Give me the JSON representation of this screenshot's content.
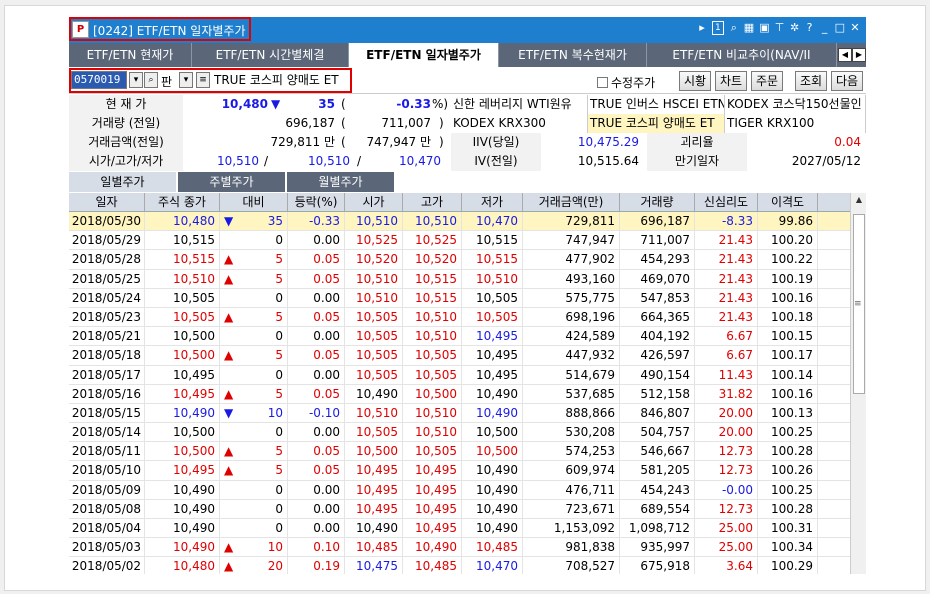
{
  "window": {
    "title": "[0242] ETF/ETN 일자별주가"
  },
  "tabs": [
    "ETF/ETN 현재가",
    "ETF/ETN 시간별체결",
    "ETF/ETN 일자별주가",
    "ETF/ETN 복수현재가",
    "ETF/ETN 비교추이(NAV/II"
  ],
  "toolbar": {
    "code": "0570019",
    "pan_label": "판",
    "name": "TRUE 코스피 양매도 ET",
    "adj_label": "수정주가",
    "buttons": [
      "시황",
      "차트",
      "주문",
      "조회",
      "다음"
    ]
  },
  "info": {
    "cur_label": "현 재 가",
    "cur_price": "10,480",
    "cur_arrow": "▼",
    "cur_diff": "35",
    "cur_pct": "-0.33",
    "vol_label": "거래량 (전일)",
    "vol": "696,187",
    "vol_prev": "711,007",
    "amt_label": "거래금액(전일)",
    "amt": "729,811 만",
    "amt_prev": "747,947 만",
    "ohl_label": "시가/고가/저가",
    "open": "10,510",
    "high": "10,510",
    "low": "10,470",
    "related": [
      "신한 레버리지 WTI원유",
      "TRUE 인버스 HSCEI ETN",
      "KODEX 코스닥150선물인",
      "KODEX KRX300",
      "TRUE 코스피 양매도 ET",
      "TIGER KRX100"
    ],
    "iiv_today_label": "IIV(당일)",
    "iiv_today": "10,475.29",
    "iiv_prev_label": "IV(전일)",
    "iiv_prev": "10,515.64",
    "gap_label": "괴리율",
    "gap": "0.04",
    "mat_label": "만기일자",
    "maturity": "2027/05/12"
  },
  "subtabs": [
    "일별주가",
    "주별주가",
    "월별주가"
  ],
  "grid": {
    "headers": [
      "일자",
      "주식 종가",
      "대비",
      "등락(%)",
      "시가",
      "고가",
      "저가",
      "거래금액(만)",
      "거래량",
      "신심리도",
      "이격도"
    ],
    "rows": [
      [
        "2018/05/30",
        "10,480",
        "▼",
        "35",
        "-0.33",
        "10,510",
        "10,510",
        "10,470",
        "729,811",
        "696,187",
        "-8.33",
        "99.86"
      ],
      [
        "2018/05/29",
        "10,515",
        "",
        "0",
        "0.00",
        "10,525",
        "10,525",
        "10,515",
        "747,947",
        "711,007",
        "21.43",
        "100.20"
      ],
      [
        "2018/05/28",
        "10,515",
        "▲",
        "5",
        "0.05",
        "10,520",
        "10,520",
        "10,515",
        "477,902",
        "454,293",
        "21.43",
        "100.22"
      ],
      [
        "2018/05/25",
        "10,510",
        "▲",
        "5",
        "0.05",
        "10,510",
        "10,515",
        "10,510",
        "493,160",
        "469,070",
        "21.43",
        "100.19"
      ],
      [
        "2018/05/24",
        "10,505",
        "",
        "0",
        "0.00",
        "10,510",
        "10,515",
        "10,505",
        "575,775",
        "547,853",
        "21.43",
        "100.16"
      ],
      [
        "2018/05/23",
        "10,505",
        "▲",
        "5",
        "0.05",
        "10,505",
        "10,510",
        "10,505",
        "698,196",
        "664,365",
        "21.43",
        "100.18"
      ],
      [
        "2018/05/21",
        "10,500",
        "",
        "0",
        "0.00",
        "10,505",
        "10,510",
        "10,495",
        "424,589",
        "404,192",
        "6.67",
        "100.15"
      ],
      [
        "2018/05/18",
        "10,500",
        "▲",
        "5",
        "0.05",
        "10,505",
        "10,505",
        "10,495",
        "447,932",
        "426,597",
        "6.67",
        "100.17"
      ],
      [
        "2018/05/17",
        "10,495",
        "",
        "0",
        "0.00",
        "10,505",
        "10,505",
        "10,495",
        "514,679",
        "490,154",
        "11.43",
        "100.14"
      ],
      [
        "2018/05/16",
        "10,495",
        "▲",
        "5",
        "0.05",
        "10,490",
        "10,500",
        "10,490",
        "537,685",
        "512,158",
        "31.82",
        "100.16"
      ],
      [
        "2018/05/15",
        "10,490",
        "▼",
        "10",
        "-0.10",
        "10,510",
        "10,510",
        "10,490",
        "888,866",
        "846,807",
        "20.00",
        "100.13"
      ],
      [
        "2018/05/14",
        "10,500",
        "",
        "0",
        "0.00",
        "10,505",
        "10,510",
        "10,500",
        "530,208",
        "504,757",
        "20.00",
        "100.25"
      ],
      [
        "2018/05/11",
        "10,500",
        "▲",
        "5",
        "0.05",
        "10,500",
        "10,505",
        "10,500",
        "574,253",
        "546,667",
        "12.73",
        "100.28"
      ],
      [
        "2018/05/10",
        "10,495",
        "▲",
        "5",
        "0.05",
        "10,495",
        "10,495",
        "10,490",
        "609,974",
        "581,205",
        "12.73",
        "100.26"
      ],
      [
        "2018/05/09",
        "10,490",
        "",
        "0",
        "0.00",
        "10,495",
        "10,495",
        "10,490",
        "476,711",
        "454,243",
        "-0.00",
        "100.25"
      ],
      [
        "2018/05/08",
        "10,490",
        "",
        "0",
        "0.00",
        "10,495",
        "10,495",
        "10,490",
        "723,671",
        "689,554",
        "12.73",
        "100.28"
      ],
      [
        "2018/05/04",
        "10,490",
        "",
        "0",
        "0.00",
        "10,490",
        "10,495",
        "10,490",
        "1,153,092",
        "1,098,712",
        "25.00",
        "100.31"
      ],
      [
        "2018/05/03",
        "10,490",
        "▲",
        "10",
        "0.10",
        "10,485",
        "10,490",
        "10,485",
        "981,838",
        "935,997",
        "25.00",
        "100.34"
      ],
      [
        "2018/05/02",
        "10,480",
        "▲",
        "20",
        "0.19",
        "10,475",
        "10,485",
        "10,470",
        "708,527",
        "675,918",
        "3.64",
        "100.29"
      ]
    ]
  },
  "colors": {
    "up": "#e00000",
    "down": "#1a1ae6",
    "title_bar": "#1e7fcf",
    "tab_bg": "#5b6779",
    "highlight": "#fff5c0",
    "annotation": "#e00000"
  }
}
